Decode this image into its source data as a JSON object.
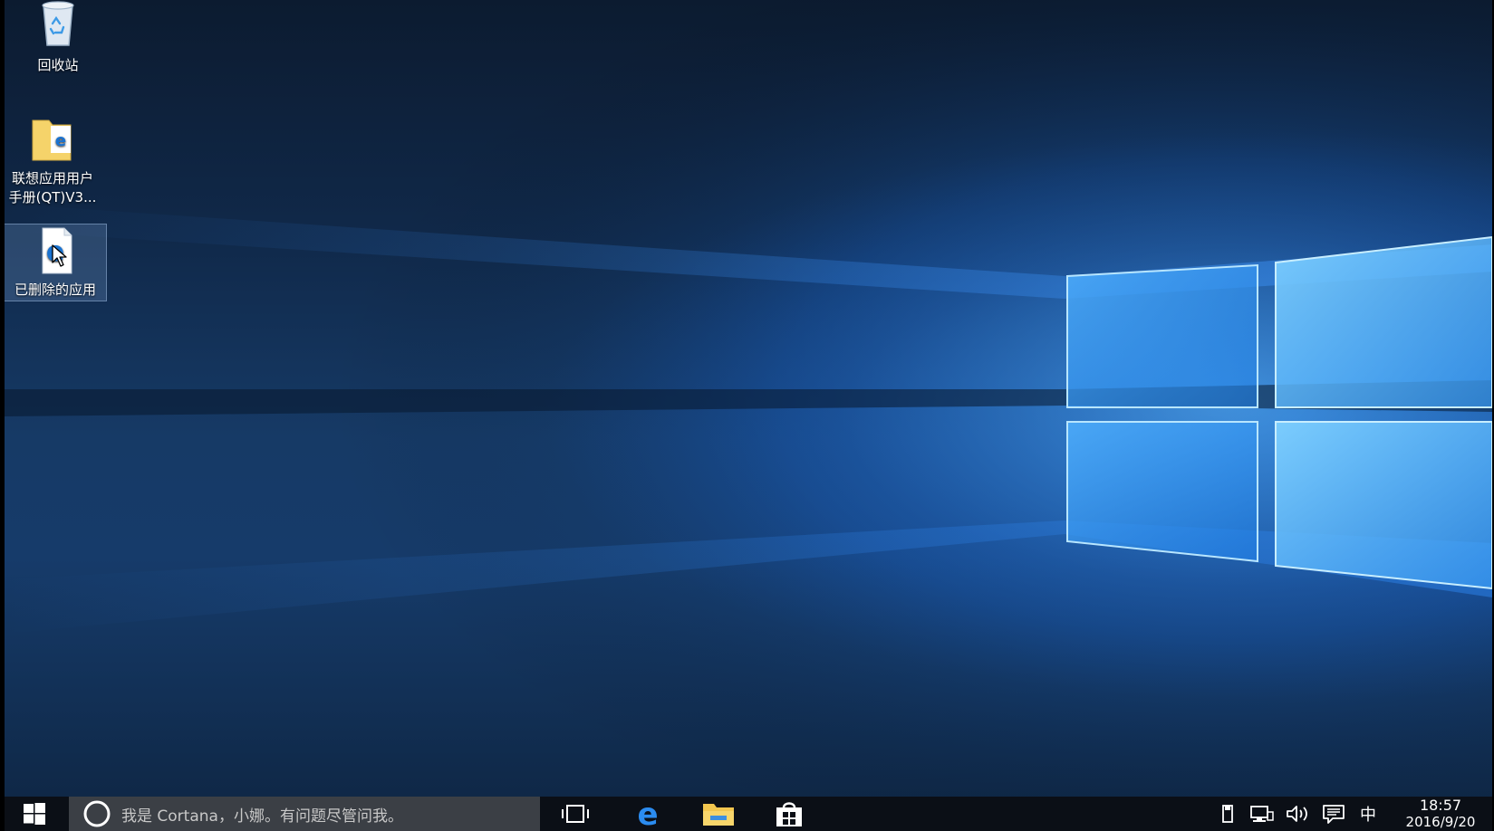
{
  "desktop": {
    "icons": [
      {
        "label_line1": "回收站",
        "label_line2": ""
      },
      {
        "label_line1": "联想应用用户",
        "label_line2": "手册(QT)V3..."
      },
      {
        "label_line1": "已删除的应用",
        "label_line2": ""
      }
    ],
    "selected_icon_index": 2
  },
  "taskbar": {
    "search_placeholder": "我是 Cortana，小娜。有问题尽管问我。",
    "pinned": [
      "task-view",
      "microsoft-edge",
      "file-explorer",
      "store"
    ],
    "ime": "中",
    "clock": {
      "time": "18:57",
      "date": "2016/9/20"
    }
  },
  "colors": {
    "taskbar_bg": "#0b0f16",
    "search_bg": "#3b3f45",
    "accent_blue": "#1e88ff"
  },
  "icons": {
    "start": "windows-logo-icon",
    "search": "cortana-circle-icon",
    "task_view": "task-view-icon",
    "edge": "edge-browser-icon",
    "explorer": "folder-icon",
    "store": "store-bag-icon",
    "tray": [
      "usb-device-icon",
      "network-icon",
      "volume-icon",
      "action-center-icon"
    ]
  }
}
